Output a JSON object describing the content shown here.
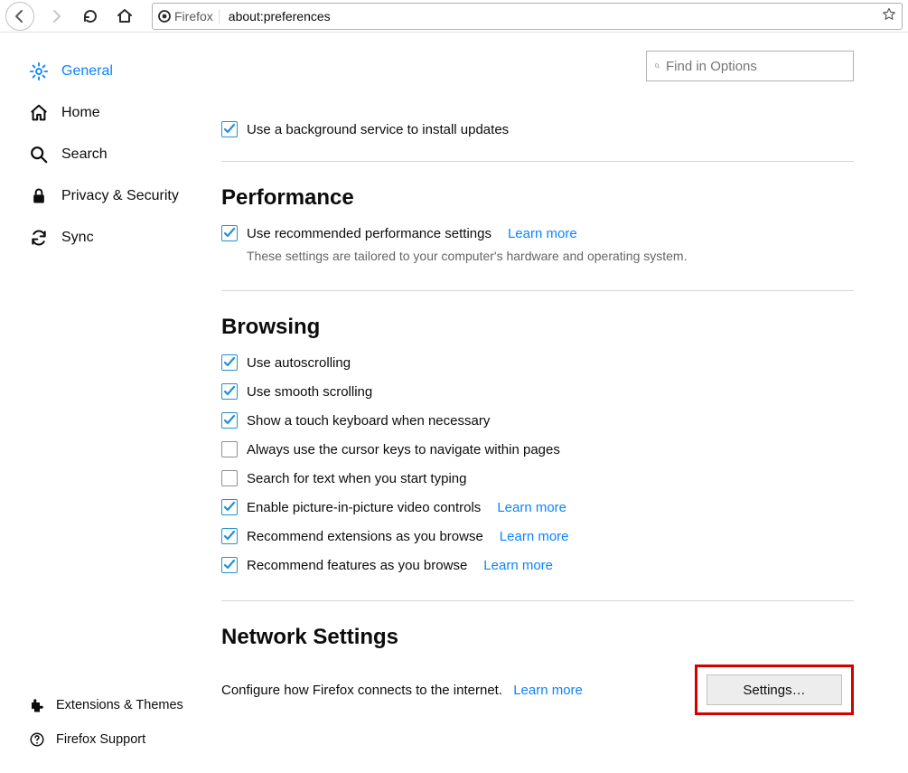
{
  "toolbar": {
    "identity": "Firefox",
    "url": "about:preferences"
  },
  "search": {
    "placeholder": "Find in Options"
  },
  "sidebar": {
    "items": [
      {
        "label": "General"
      },
      {
        "label": "Home"
      },
      {
        "label": "Search"
      },
      {
        "label": "Privacy & Security"
      },
      {
        "label": "Sync"
      }
    ],
    "footer": [
      {
        "label": "Extensions & Themes"
      },
      {
        "label": "Firefox Support"
      }
    ]
  },
  "updates": {
    "bg_service": "Use a background service to install updates"
  },
  "performance": {
    "heading": "Performance",
    "recommended": "Use recommended performance settings",
    "learn_more": "Learn more",
    "desc": "These settings are tailored to your computer's hardware and operating system."
  },
  "browsing": {
    "heading": "Browsing",
    "autoscroll": "Use autoscrolling",
    "smooth": "Use smooth scrolling",
    "touch": "Show a touch keyboard when necessary",
    "cursor": "Always use the cursor keys to navigate within pages",
    "searchtext": "Search for text when you start typing",
    "pip": "Enable picture-in-picture video controls",
    "rec_ext": "Recommend extensions as you browse",
    "rec_feat": "Recommend features as you browse",
    "learn_more": "Learn more"
  },
  "network": {
    "heading": "Network Settings",
    "desc": "Configure how Firefox connects to the internet.",
    "learn_more": "Learn more",
    "button": "Settings…"
  }
}
